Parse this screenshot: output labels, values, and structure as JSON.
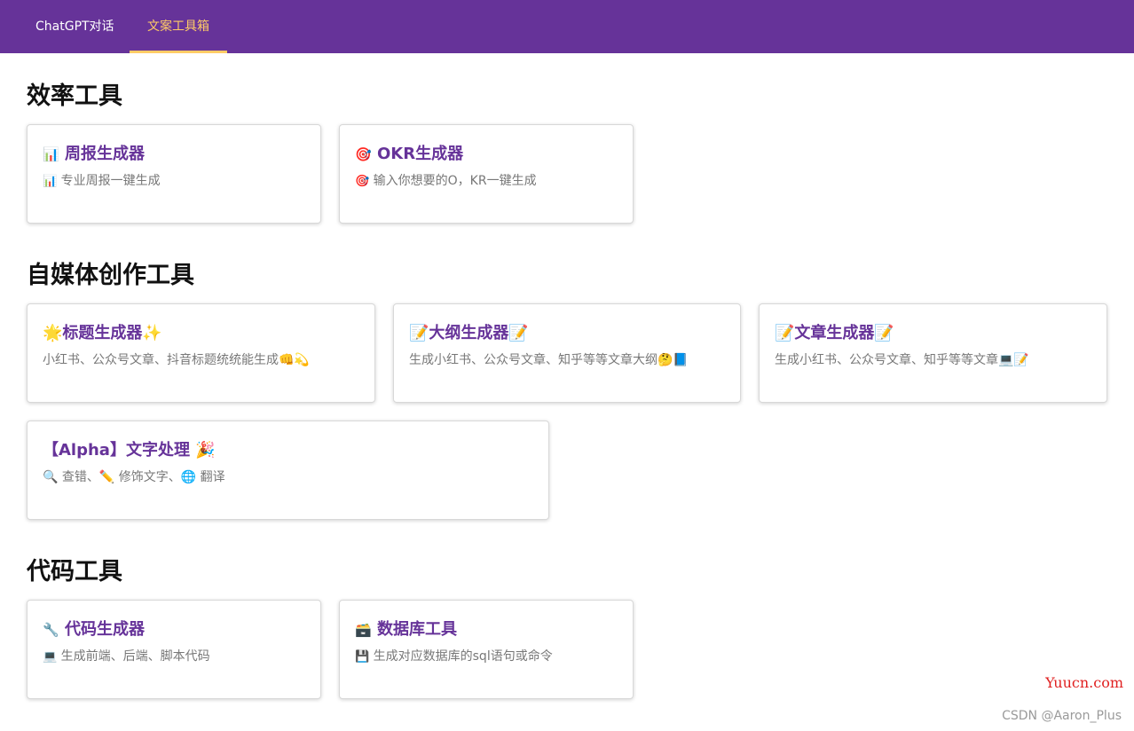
{
  "nav": {
    "tabs": [
      {
        "label": "ChatGPT对话",
        "active": false
      },
      {
        "label": "文案工具箱",
        "active": true
      }
    ]
  },
  "sections": [
    {
      "title": "效率工具",
      "cards": [
        {
          "icon": "📊",
          "title": "周报生成器",
          "desc_icon": "📊",
          "desc": "专业周报一键生成"
        },
        {
          "icon": "🎯",
          "title": "OKR生成器",
          "desc_icon": "🎯",
          "desc": "输入你想要的O，KR一键生成"
        }
      ]
    },
    {
      "title": "自媒体创作工具",
      "cards": [
        {
          "title": "🌟标题生成器✨",
          "desc": "小红书、公众号文章、抖音标题统统能生成👊💫"
        },
        {
          "title": "📝大纲生成器📝",
          "desc": "生成小红书、公众号文章、知乎等等文章大纲🤔📘"
        },
        {
          "title": "📝文章生成器📝",
          "desc": "生成小红书、公众号文章、知乎等等文章💻📝"
        },
        {
          "title": "【Alpha】文字处理 🎉",
          "desc": "🔍 查错、✏️ 修饰文字、🌐 翻译"
        }
      ]
    },
    {
      "title": "代码工具",
      "cards": [
        {
          "icon": "🔧",
          "title": "代码生成器",
          "desc_icon": "💻",
          "desc": "生成前端、后端、脚本代码"
        },
        {
          "icon": "🗃️",
          "title": "数据库工具",
          "desc_icon": "💾",
          "desc": "生成对应数据库的sql语句或命令"
        }
      ]
    }
  ],
  "watermarks": {
    "site": "Yuucn.com",
    "author": "CSDN @Aaron_Plus"
  },
  "colors": {
    "nav_bg": "#663399",
    "nav_active": "#ffcc66",
    "card_title": "#663399",
    "desc_text": "#777777",
    "watermark_site": "#e02020"
  }
}
